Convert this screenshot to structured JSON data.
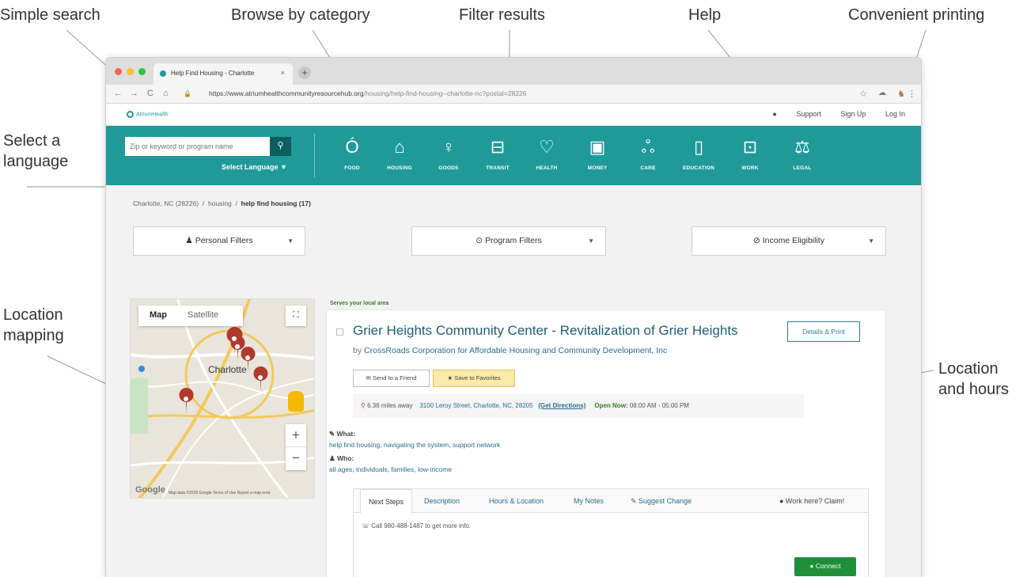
{
  "callouts": {
    "simple_search": "Simple search",
    "browse_by_category": "Browse by category",
    "filter_results": "Filter results",
    "help": "Help",
    "convenient_printing": "Convenient printing",
    "select_language_1": "Select a",
    "select_language_2": "language",
    "location_mapping_1": "Location",
    "location_mapping_2": "mapping",
    "location_hours_1": "Location",
    "location_hours_2": "and hours"
  },
  "browser": {
    "tab_title": "Help Find Housing - Charlotte",
    "tab_close": "×",
    "new_tab": "+",
    "url_prefix": "https://www.atriumhealthcommunityresourcehub.org",
    "url_path": "/housing/help-find-housing--charlotte-nc?postal=28226",
    "back": "←",
    "forward": "→",
    "reload": "C",
    "home": "⌂",
    "lock": "🔒",
    "star": "☆",
    "more": "⋮"
  },
  "site": {
    "logo_text": "AtriumHealth",
    "support": "Support",
    "sign_up": "Sign Up",
    "log_in": "Log In",
    "search_placeholder": "Zip or keyword or program name",
    "search_icon": "search-icon",
    "select_language": "Select Language ▼"
  },
  "categories": [
    {
      "label": "FOOD",
      "icon": "apple-icon",
      "glyph": "Ó"
    },
    {
      "label": "HOUSING",
      "icon": "house-icon",
      "glyph": "⌂"
    },
    {
      "label": "GOODS",
      "icon": "lamp-icon",
      "glyph": "♀"
    },
    {
      "label": "TRANSIT",
      "icon": "bus-icon",
      "glyph": "⊟"
    },
    {
      "label": "HEALTH",
      "icon": "heart-icon",
      "glyph": "♡"
    },
    {
      "label": "MONEY",
      "icon": "money-icon",
      "glyph": "▣"
    },
    {
      "label": "CARE",
      "icon": "people-icon",
      "glyph": "ஃ"
    },
    {
      "label": "EDUCATION",
      "icon": "book-icon",
      "glyph": "▯"
    },
    {
      "label": "WORK",
      "icon": "briefcase-icon",
      "glyph": "⊡"
    },
    {
      "label": "LEGAL",
      "icon": "scales-icon",
      "glyph": "⚖"
    }
  ],
  "breadcrumb": {
    "location": "Charlotte, NC (28226)",
    "sep": "/",
    "category": "housing",
    "current": "help find housing (17)"
  },
  "filters": {
    "personal": "♟ Personal Filters",
    "program": "⊙ Program Filters",
    "income": "⊘ Income Eligibility",
    "caret": "▼"
  },
  "map": {
    "tab_map": "Map",
    "tab_satellite": "Satellite",
    "fullscreen": "⛶",
    "zoom_in": "+",
    "zoom_out": "−",
    "city_label": "Charlotte",
    "google": "Google",
    "credit": "Map data ©2018 Google   Terms of Use   Report a map error"
  },
  "listing": {
    "serves": "Serves your local area",
    "title": "Grier Heights Community Center - Revitalization of Grier Heights",
    "by_prefix": "by",
    "provider": "CrossRoads Corporation for Affordable Housing and Community Development, Inc",
    "details_print": "Details & Print",
    "send_friend": "✉ Send to a Friend",
    "save_favorites": "★ Save to Favorites",
    "pin": "⚲",
    "distance": "6.36 miles away",
    "address": "3100 Leroy Street, Charlotte, NC, 28205",
    "get_directions": "(Get Directions)",
    "open_now_label": "Open Now:",
    "open_hours": "08:00 AM - 05:00 PM",
    "what_label": "✎ What:",
    "what_value": "help find housing,  navigating the system,  support network",
    "who_label": "♟ Who:",
    "who_value": "all ages,  individuals,  families,  low-income"
  },
  "detail_tabs": {
    "next_steps": "Next Steps",
    "description": "Description",
    "hours_location": "Hours & Location",
    "my_notes": "My Notes",
    "suggest_change": "✎ Suggest Change",
    "work_here": "● Work here? Claim!",
    "call_text": "☏  Call 980-488-1487 to get more info.",
    "connect": "● Connect"
  },
  "colors": {
    "brand_teal": "#1f9a99",
    "link_blue": "#2c6b8c",
    "connect_green": "#1f8f3a",
    "pin_red": "#b03a2e"
  }
}
